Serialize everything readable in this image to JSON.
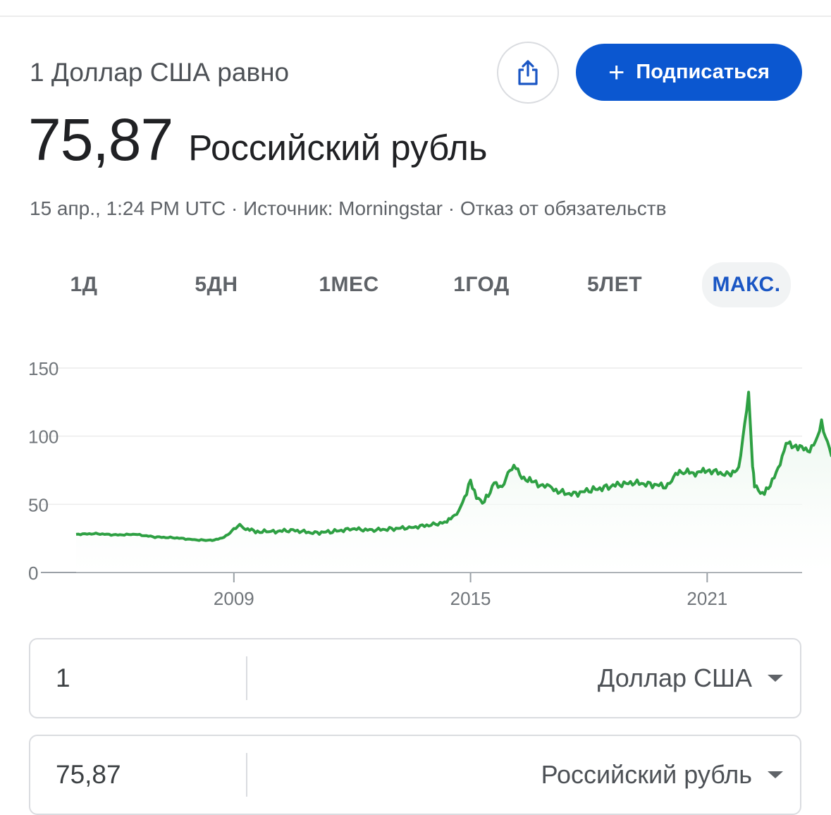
{
  "header": {
    "subtitle": "1 Доллар США равно",
    "rate_value": "75,87",
    "rate_currency": "Российский рубль",
    "meta": "15 апр., 1:24 PM UTC · Источник: Morningstar · Отказ от обязательств",
    "subscribe_label": "Подписаться"
  },
  "tabs": [
    {
      "label": "1Д",
      "active": false
    },
    {
      "label": "5ДН",
      "active": false
    },
    {
      "label": "1МЕС",
      "active": false
    },
    {
      "label": "1ГОД",
      "active": false
    },
    {
      "label": "5ЛЕТ",
      "active": false
    },
    {
      "label": "МАКС.",
      "active": true
    }
  ],
  "chart_data": {
    "type": "area",
    "title": "",
    "xlabel": "",
    "ylabel": "",
    "ylim": [
      0,
      150
    ],
    "xlim": [
      2005.0,
      2024.3
    ],
    "y_ticks": [
      0,
      50,
      100,
      150
    ],
    "x_ticks": [
      2009,
      2015,
      2021
    ],
    "grid": true,
    "line_color": "#2ea043",
    "fill_color": "#e6f4ea",
    "x": [
      2005.0,
      2005.5,
      2006.0,
      2006.5,
      2007.0,
      2007.5,
      2008.0,
      2008.4,
      2008.7,
      2008.9,
      2009.1,
      2009.3,
      2009.6,
      2010.0,
      2010.5,
      2011.0,
      2011.5,
      2012.0,
      2012.5,
      2013.0,
      2013.5,
      2014.0,
      2014.4,
      2014.7,
      2014.85,
      2015.0,
      2015.15,
      2015.35,
      2015.6,
      2015.8,
      2016.0,
      2016.1,
      2016.3,
      2016.6,
      2017.0,
      2017.5,
      2018.0,
      2018.5,
      2019.0,
      2019.5,
      2020.0,
      2020.2,
      2020.4,
      2020.7,
      2021.0,
      2021.5,
      2021.8,
      2022.05,
      2022.15,
      2022.2,
      2022.35,
      2022.5,
      2022.8,
      2023.0,
      2023.3,
      2023.6,
      2023.75,
      2023.9,
      2024.1,
      2024.3
    ],
    "values": [
      28,
      28.5,
      27.5,
      28,
      26,
      25.5,
      24,
      23.5,
      25,
      29,
      35,
      32,
      30,
      30,
      31,
      29,
      30,
      32,
      31,
      32,
      33,
      35,
      37,
      45,
      55,
      68,
      55,
      52,
      65,
      62,
      75,
      80,
      70,
      66,
      62,
      57,
      60,
      63,
      66,
      65,
      63,
      72,
      74,
      73,
      75,
      72,
      75,
      132,
      80,
      65,
      58,
      60,
      75,
      95,
      92,
      90,
      96,
      110,
      90,
      77
    ]
  }
}
